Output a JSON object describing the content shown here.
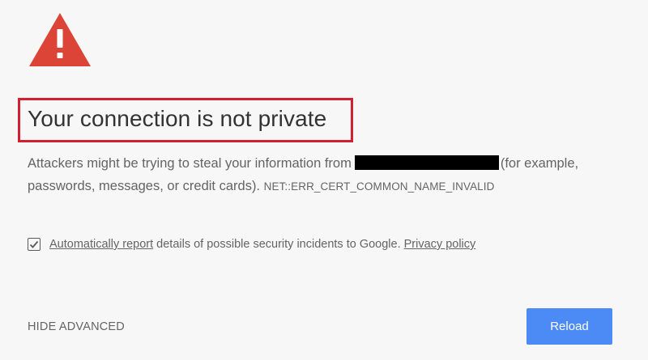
{
  "icon": {
    "name": "warning-triangle-icon",
    "color": "#db4437"
  },
  "title": "Your connection is not private",
  "title_highlight_color": "#d1202f",
  "message": {
    "part1": "Attackers might be trying to steal your information from",
    "part2": "(for example, passwords, messages, or credit cards).",
    "error_code": "NET::ERR_CERT_COMMON_NAME_INVALID"
  },
  "report": {
    "checked": true,
    "link_label": "Automatically report",
    "text": " details of possible security incidents to Google. ",
    "privacy_label": "Privacy policy"
  },
  "buttons": {
    "advanced_label": "HIDE ADVANCED",
    "reload_label": "Reload",
    "reload_color": "#4c8bf5"
  }
}
